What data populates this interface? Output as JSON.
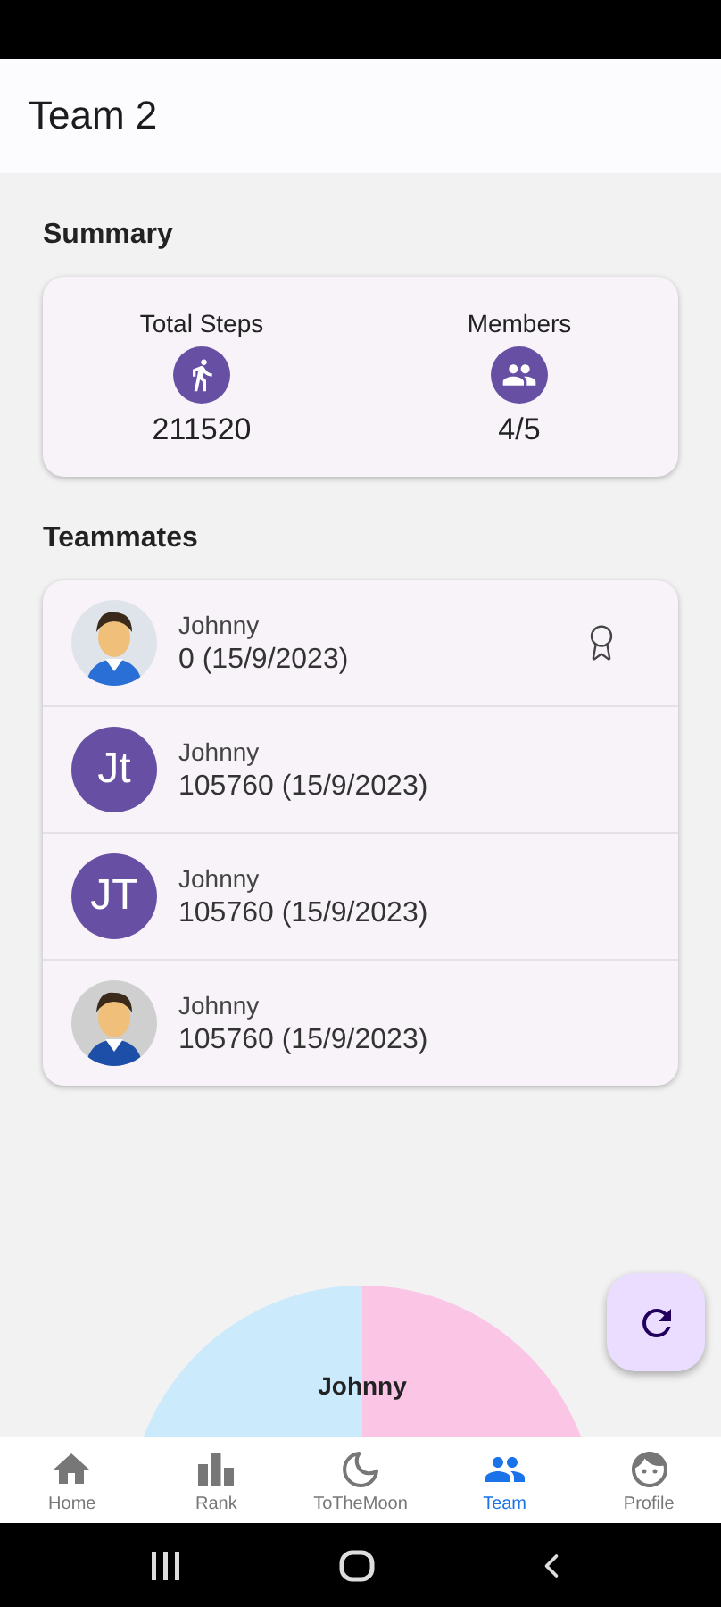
{
  "header": {
    "title": "Team 2"
  },
  "summary": {
    "title": "Summary",
    "stats": [
      {
        "kind": "steps",
        "label": "Total Steps",
        "value": "211520"
      },
      {
        "kind": "members",
        "label": "Members",
        "value": "4/5"
      }
    ]
  },
  "teammates": {
    "title": "Teammates",
    "rows": [
      {
        "name": "Johnny",
        "detail": "0 (15/9/2023)",
        "award": true
      },
      {
        "avatar": {
          "kind": "initials",
          "text": "Jt"
        },
        "name": "Johnny",
        "detail": "105760 (15/9/2023)",
        "award": false
      },
      {
        "avatar": {
          "kind": "initials",
          "text": "JT"
        },
        "name": "Johnny",
        "detail": "105760 (15/9/2023)",
        "award": false
      },
      {
        "name": "Johnny",
        "detail": "105760 (15/9/2023)",
        "award": false
      }
    ]
  },
  "chart": {
    "label": "Johnny",
    "slices": [
      {
        "color": "#cbeafb"
      },
      {
        "color": "#fbc6e6"
      }
    ]
  },
  "bottom_nav": [
    {
      "kind": "home",
      "label": "Home",
      "selected": false
    },
    {
      "kind": "rank",
      "label": "Rank",
      "selected": false
    },
    {
      "kind": "moon",
      "label": "ToTheMoon",
      "selected": false
    },
    {
      "kind": "team",
      "label": "Team",
      "selected": true
    },
    {
      "kind": "profile",
      "label": "Profile",
      "selected": false
    }
  ]
}
